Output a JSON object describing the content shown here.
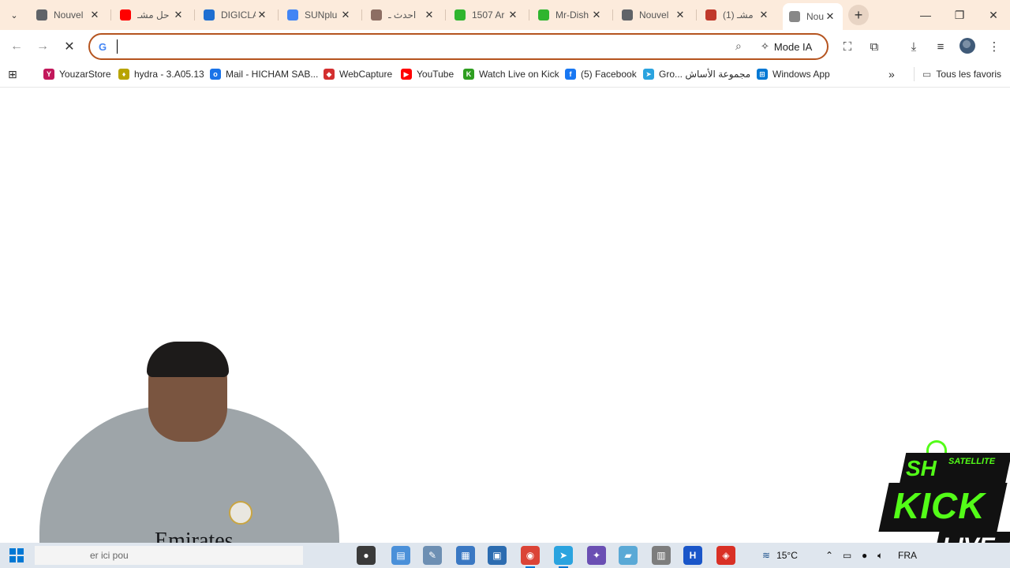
{
  "tabs": [
    {
      "title": "Nouvel",
      "icon": "chrome-icon",
      "color": "#5f6368"
    },
    {
      "title": "حل مشـ",
      "icon": "youtube-icon",
      "color": "#ff0000"
    },
    {
      "title": "DIGICLA",
      "icon": "digicla-icon",
      "color": "#1f6fd1"
    },
    {
      "title": "SUNplu",
      "icon": "google-icon",
      "color": "#4285f4"
    },
    {
      "title": "احدث ـ",
      "icon": "cookie-icon",
      "color": "#8d6e63"
    },
    {
      "title": "1507 Ar",
      "icon": "flag-icon",
      "color": "#2fb52f"
    },
    {
      "title": "Mr-Dish",
      "icon": "flag-icon",
      "color": "#2fb52f"
    },
    {
      "title": "Nouvel",
      "icon": "chrome-icon",
      "color": "#5f6368"
    },
    {
      "title": "(1) مشـ",
      "icon": "bird-icon",
      "color": "#c0392b"
    },
    {
      "title": "Nou",
      "icon": "loading-icon",
      "color": "#888888",
      "active": true
    }
  ],
  "toolbar": {
    "back": "←",
    "forward": "→",
    "stop": "✕",
    "omnibox_value": "",
    "google_g": "G",
    "mode_ia": "Mode IA"
  },
  "bookmarks": [
    {
      "label": "YouzarStore",
      "icon": "youzar-icon",
      "color": "#c2185b",
      "glyph": "Y"
    },
    {
      "label": "hydra - 3.A05.13",
      "icon": "hydra-icon",
      "color": "#b8a400",
      "glyph": "♦"
    },
    {
      "label": "Mail - HICHAM SAB...",
      "icon": "outlook-icon",
      "color": "#1a73e8",
      "glyph": "o"
    },
    {
      "label": "WebCapture",
      "icon": "webcapture-icon",
      "color": "#d32f2f",
      "glyph": "◆"
    },
    {
      "label": "YouTube",
      "icon": "youtube-icon",
      "color": "#ff0000",
      "glyph": "▶"
    },
    {
      "label": "Watch Live on Kick",
      "icon": "kick-icon",
      "color": "#2e9e20",
      "glyph": "K"
    },
    {
      "label": "(5) Facebook",
      "icon": "facebook-icon",
      "color": "#1877f2",
      "glyph": "f"
    },
    {
      "label": "Gro... مجموعة الأساش",
      "icon": "telegram-icon",
      "color": "#2aa3df",
      "glyph": "➤"
    },
    {
      "label": "Windows App",
      "icon": "windows-icon",
      "color": "#0078d4",
      "glyph": "⊞"
    }
  ],
  "bookmarks_overflow": "»",
  "all_bookmarks": "Tous les favoris",
  "overlay": {
    "shirt_text": "Emirates",
    "kick_line1": "SH",
    "kick_line1b": "SATELLITE",
    "kick_line2": "KICK",
    "kick_line3": "LIVE"
  },
  "taskbar": {
    "search_placeholder": "er ici pou",
    "weather": "15°C",
    "language": "FRA",
    "apps": [
      {
        "name": "screenrec-icon",
        "color": "#3a3a3a",
        "glyph": "●"
      },
      {
        "name": "files-icon",
        "color": "#4a90d9",
        "glyph": "▤"
      },
      {
        "name": "paint-icon",
        "color": "#6d8fb3",
        "glyph": "✎"
      },
      {
        "name": "calculator-icon",
        "color": "#3a78c3",
        "glyph": "▦"
      },
      {
        "name": "store-icon",
        "color": "#2c6cb0",
        "glyph": "▣"
      },
      {
        "name": "chrome-icon",
        "color": "#db4437",
        "glyph": "◉"
      },
      {
        "name": "telegram-icon",
        "color": "#2aa3df",
        "glyph": "➤"
      },
      {
        "name": "star-app-icon",
        "color": "#6a4fb3",
        "glyph": "✦"
      },
      {
        "name": "notes-icon",
        "color": "#5aa9d6",
        "glyph": "▰"
      },
      {
        "name": "archive-icon",
        "color": "#7d7d7d",
        "glyph": "▥"
      },
      {
        "name": "h-app-icon",
        "color": "#1a56c9",
        "glyph": "H"
      },
      {
        "name": "anydesk-icon",
        "color": "#d93025",
        "glyph": "◈"
      }
    ]
  }
}
